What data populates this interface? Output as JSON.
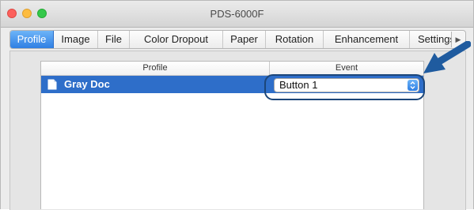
{
  "window": {
    "title": "PDS-6000F"
  },
  "tabs": [
    {
      "label": "Profile",
      "active": true
    },
    {
      "label": "Image",
      "active": false
    },
    {
      "label": "File",
      "active": false
    },
    {
      "label": "Color Dropout",
      "active": false
    },
    {
      "label": "Paper",
      "active": false
    },
    {
      "label": "Rotation",
      "active": false
    },
    {
      "label": "Enhancement",
      "active": false
    },
    {
      "label": "Settings",
      "active": false
    }
  ],
  "tab_scroll_icon": "triangle-right-icon",
  "table": {
    "columns": [
      "Profile",
      "Event"
    ],
    "rows": [
      {
        "icon": "document-icon",
        "profile": "Gray Doc",
        "event": "Button 1",
        "selected": true
      }
    ]
  },
  "colors": {
    "accent": "#2e6ec9",
    "callout": "#1c4679",
    "arrow": "#1f5b9f"
  }
}
